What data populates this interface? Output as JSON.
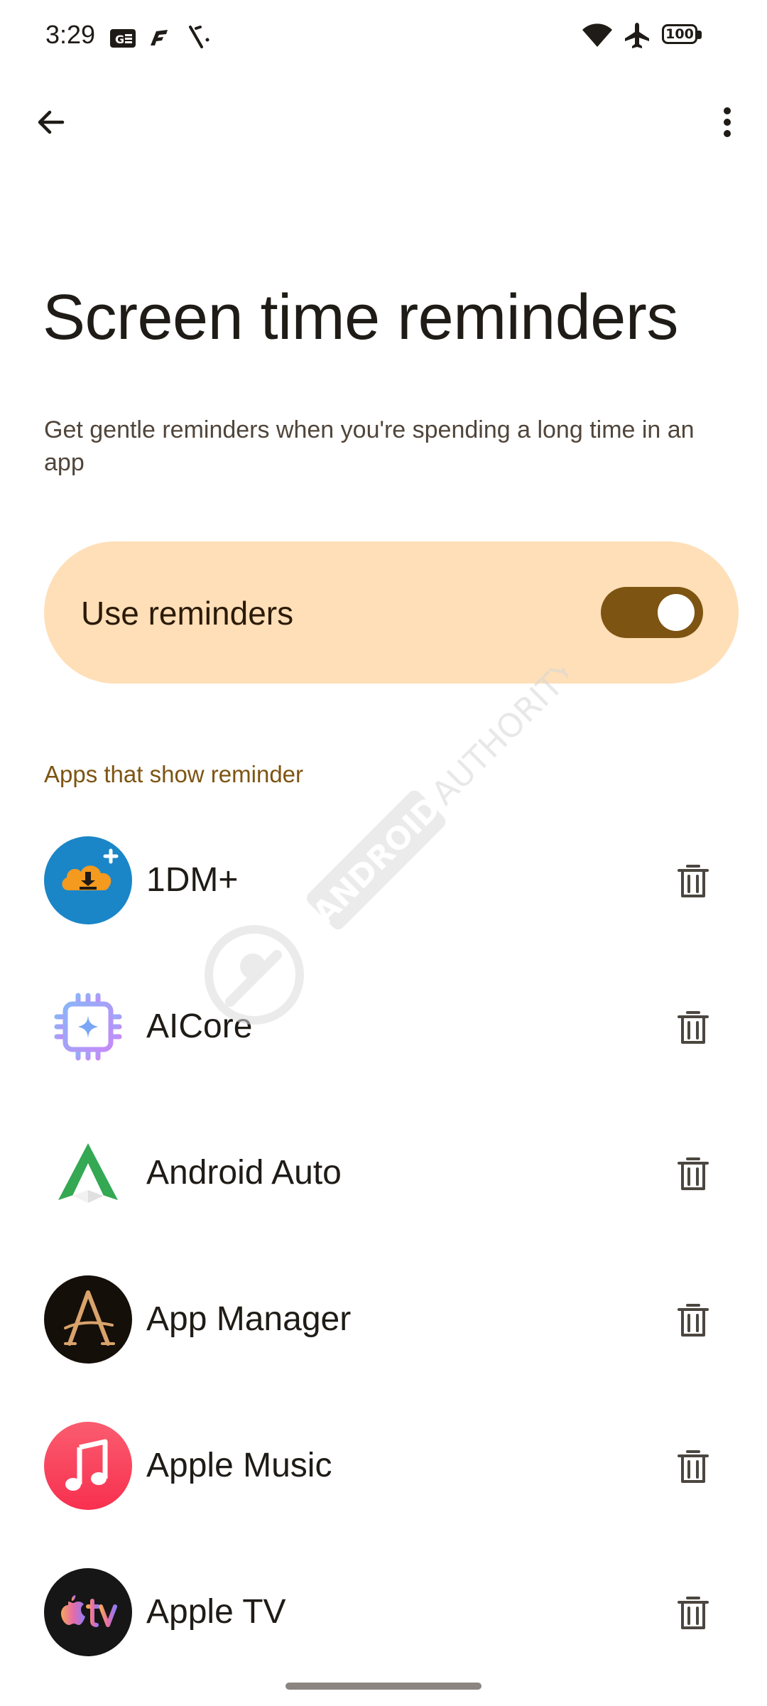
{
  "status_bar": {
    "time": "3:29",
    "battery": "100",
    "icons": [
      "gboard-icon",
      "fenix-icon",
      "notification-icon",
      "wifi-icon",
      "airplane-icon",
      "battery-icon"
    ]
  },
  "top_bar": {
    "back_icon": "arrow-back-icon",
    "more_icon": "more-vert-icon"
  },
  "title": "Screen time reminders",
  "subtitle": "Get gentle reminders when you're spending a long time in an app",
  "toggle": {
    "label": "Use reminders",
    "checked": true
  },
  "section_header": "Apps that show reminder",
  "apps": [
    {
      "name": "1DM+",
      "icon": "1dm-download-icon"
    },
    {
      "name": "AICore",
      "icon": "aicore-chip-icon"
    },
    {
      "name": "Android Auto",
      "icon": "android-auto-icon"
    },
    {
      "name": "App Manager",
      "icon": "app-manager-icon"
    },
    {
      "name": "Apple Music",
      "icon": "apple-music-icon"
    },
    {
      "name": "Apple TV",
      "icon": "apple-tv-icon"
    }
  ],
  "delete_icon": "trash-icon",
  "watermark": {
    "text": "ANDROID AUTHORITY"
  },
  "colors": {
    "accent": "#7d5412",
    "card_background": "#ffdfb8",
    "text_primary": "#1f1b16",
    "text_secondary": "#50453a"
  }
}
